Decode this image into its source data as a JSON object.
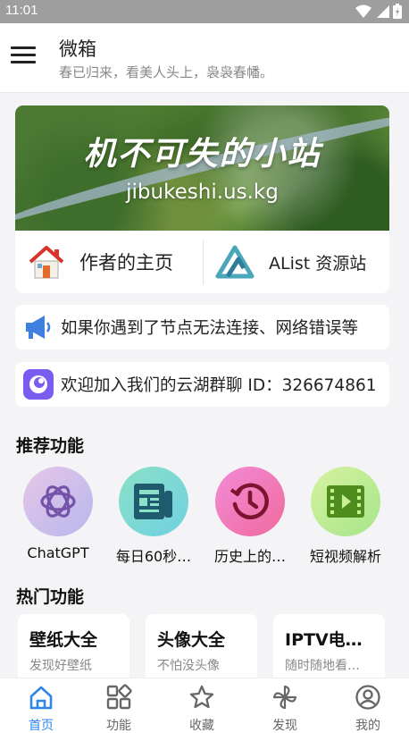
{
  "status_bar": {
    "time": "11:01"
  },
  "app_bar": {
    "title": "微箱",
    "subtitle": "春已归来，看美人头上，袅袅春幡。"
  },
  "banner": {
    "title": "机不可失的小站",
    "url": "jibukeshi.us.kg"
  },
  "links": [
    {
      "label": "作者的主页",
      "icon": "house-icon"
    },
    {
      "label": "AList 资源站",
      "icon": "alist-logo-icon"
    }
  ],
  "notices": [
    {
      "text": "如果你遇到了节点无法连接、网络错误等",
      "icon": "megaphone-icon"
    },
    {
      "text": "欢迎加入我们的云湖群聊 ID：326674861",
      "icon": "chat-app-icon"
    }
  ],
  "recommended": {
    "title": "推荐功能",
    "items": [
      {
        "label": "ChatGPT",
        "icon": "openai-icon"
      },
      {
        "label": "每日60秒…",
        "icon": "newspaper-icon"
      },
      {
        "label": "历史上的…",
        "icon": "history-clock-icon"
      },
      {
        "label": "短视频解析",
        "icon": "film-icon"
      }
    ]
  },
  "hot": {
    "title": "热门功能",
    "items": [
      {
        "title": "壁纸大全",
        "subtitle": "发现好壁纸"
      },
      {
        "title": "头像大全",
        "subtitle": "不怕没头像"
      },
      {
        "title": "IPTV电…",
        "subtitle": "随时随地看…"
      }
    ]
  },
  "bottom_nav": [
    {
      "label": "首页",
      "icon": "home-icon",
      "active": true
    },
    {
      "label": "功能",
      "icon": "apps-grid-icon",
      "active": false
    },
    {
      "label": "收藏",
      "icon": "star-icon",
      "active": false
    },
    {
      "label": "发现",
      "icon": "pinwheel-icon",
      "active": false
    },
    {
      "label": "我的",
      "icon": "profile-icon",
      "active": false
    }
  ],
  "colors": {
    "accent": "#2f86e8",
    "status_bar": "#9e9e9e",
    "background": "#f4f4f6"
  }
}
